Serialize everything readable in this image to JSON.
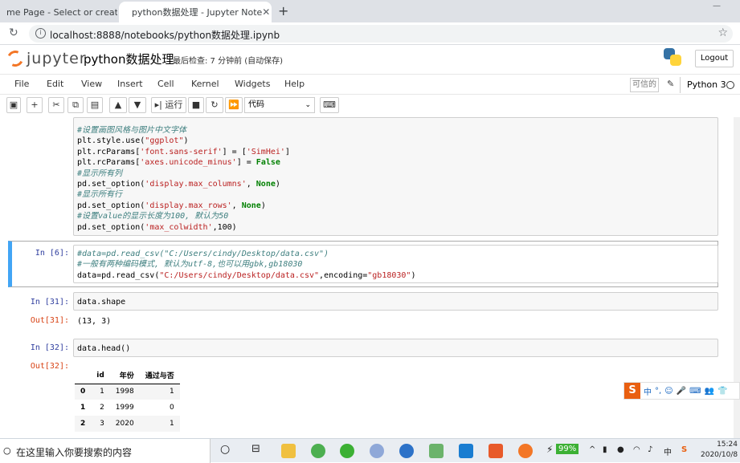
{
  "browser": {
    "tabs": [
      {
        "title": "me Page - Select or create a",
        "close": "✕"
      },
      {
        "title": "python数据处理 - Jupyter Note",
        "close": "✕"
      }
    ],
    "new_tab": "+",
    "url": "localhost:8888/notebooks/python数据处理.ipynb"
  },
  "jupyter": {
    "logo_text": "jupyter",
    "notebook_name": "python数据处理",
    "checkpoint": "最后检查: 7 分钟前   (自动保存)",
    "logout": "Logout",
    "menu": [
      "File",
      "Edit",
      "View",
      "Insert",
      "Cell",
      "Kernel",
      "Widgets",
      "Help"
    ],
    "trusted": "可信的",
    "kernel": "Python 3",
    "run_label": "运行",
    "cell_type": "代码"
  },
  "cells": {
    "c0": {
      "lines": [
        {
          "t": "#设置画图风格与图片中文字体",
          "k": "cm"
        },
        {
          "parts": [
            [
              "plt.style.use(",
              ""
            ],
            [
              "\"ggplot\"",
              "st"
            ],
            [
              ")",
              ""
            ]
          ]
        },
        {
          "parts": [
            [
              "plt.rcParams[",
              ""
            ],
            [
              "'font.sans-serif'",
              "st"
            ],
            [
              "] = [",
              ""
            ],
            [
              "'SimHei'",
              "st"
            ],
            [
              "]",
              ""
            ]
          ]
        },
        {
          "parts": [
            [
              "plt.rcParams[",
              ""
            ],
            [
              "'axes.unicode_minus'",
              "st"
            ],
            [
              "] = ",
              ""
            ],
            [
              "False",
              "kw"
            ]
          ]
        },
        {
          "t": "#显示所有列",
          "k": "cm"
        },
        {
          "parts": [
            [
              "pd.set_option(",
              ""
            ],
            [
              "'display.max_columns'",
              "st"
            ],
            [
              ", ",
              ""
            ],
            [
              "None",
              "kw"
            ],
            [
              ")",
              ""
            ]
          ]
        },
        {
          "t": "#显示所有行",
          "k": "cm"
        },
        {
          "parts": [
            [
              "pd.set_option(",
              ""
            ],
            [
              "'display.max_rows'",
              "st"
            ],
            [
              ", ",
              ""
            ],
            [
              "None",
              "kw"
            ],
            [
              ")",
              ""
            ]
          ]
        },
        {
          "t": "#设置value的显示长度为100, 默认为50",
          "k": "cm"
        },
        {
          "parts": [
            [
              "pd.set_option(",
              ""
            ],
            [
              "'max_colwidth'",
              "st"
            ],
            [
              ",100)",
              ""
            ]
          ]
        }
      ]
    },
    "c6": {
      "prompt": "In  [6]:",
      "lines": [
        {
          "t": "#data=pd.read_csv(\"C:/Users/cindy/Desktop/data.csv\")",
          "k": "cm"
        },
        {
          "t": "#一般有两种编码模式, 默认为utf-8,也可以用gbk,gb18030",
          "k": "cm"
        },
        {
          "parts": [
            [
              "data=pd.read_csv(",
              ""
            ],
            [
              "\"C:/Users/cindy/Desktop/data.csv\"",
              "st"
            ],
            [
              ",encoding=",
              ""
            ],
            [
              "\"gb18030\"",
              "st"
            ],
            [
              ")",
              ""
            ]
          ]
        }
      ]
    },
    "c31": {
      "prompt": "In  [31]:",
      "code": "data.shape",
      "out_prompt": "Out[31]:",
      "output": "(13, 3)"
    },
    "c32": {
      "prompt": "In  [32]:",
      "code": "data.head()",
      "out_prompt": "Out[32]:"
    }
  },
  "dataframe": {
    "columns": [
      "",
      "id",
      "年份",
      "通过与否"
    ],
    "rows": [
      [
        "0",
        "1",
        "1998",
        "1"
      ],
      [
        "1",
        "2",
        "1999",
        "0"
      ],
      [
        "2",
        "3",
        "2020",
        "1"
      ]
    ]
  },
  "ime": {
    "label": "S",
    "items": [
      "中",
      "°,",
      "☺",
      "🎤",
      "⌨",
      "👥",
      "👕"
    ]
  },
  "taskbar": {
    "search_placeholder": "在这里输入你要搜索的内容",
    "battery": "99%",
    "time": "15:24",
    "date": "2020/10/8"
  }
}
